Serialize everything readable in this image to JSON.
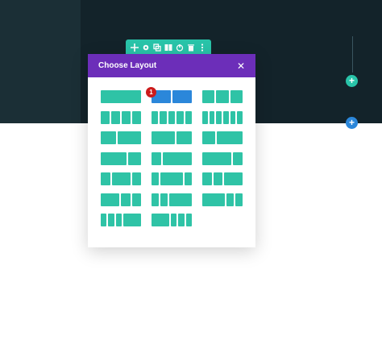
{
  "modal": {
    "title": "Choose Layout",
    "close_glyph": "✕"
  },
  "badge": {
    "count": "1"
  },
  "toolbar": {
    "icons": [
      "move-icon",
      "gear-icon",
      "duplicate-icon",
      "columns-icon",
      "power-icon",
      "trash-icon",
      "more-icon"
    ]
  },
  "side_controls": {
    "add_glyph": "+"
  },
  "colors": {
    "accent": "#29c4a9",
    "header": "#6c2eb9",
    "selected": "#2b87da",
    "badge": "#cc1b1b",
    "dark_bg": "#13232a"
  },
  "layouts": [
    {
      "name": "1 column",
      "cols": [
        4
      ]
    },
    {
      "name": "1/2 + 1/2",
      "cols": [
        1,
        1
      ],
      "selected": true
    },
    {
      "name": "1/3 + 1/3 + 1/3",
      "cols": [
        1,
        1,
        1
      ]
    },
    {
      "name": "1/4 x 4",
      "cols": [
        1,
        1,
        1,
        1
      ]
    },
    {
      "name": "1/5 x 5",
      "cols": [
        1,
        1,
        1,
        1,
        1
      ]
    },
    {
      "name": "1/6 x 6",
      "cols": [
        1,
        1,
        1,
        1,
        1,
        1
      ]
    },
    {
      "name": "2/5 + 3/5",
      "cols": [
        2,
        3
      ]
    },
    {
      "name": "3/5 + 2/5",
      "cols": [
        3,
        2
      ]
    },
    {
      "name": "1/3 + 2/3",
      "cols": [
        1,
        2
      ]
    },
    {
      "name": "2/3 + 1/3",
      "cols": [
        2,
        1
      ]
    },
    {
      "name": "1/4 + 3/4",
      "cols": [
        1,
        3
      ]
    },
    {
      "name": "3/4 + 1/4",
      "cols": [
        3,
        1
      ]
    },
    {
      "name": "1/4 + 1/2 + 1/4",
      "cols": [
        1,
        2,
        1
      ]
    },
    {
      "name": "1/5 + 3/5 + 1/5",
      "cols": [
        1,
        3,
        1
      ]
    },
    {
      "name": "1/4 + 1/4 + 1/2",
      "cols": [
        1,
        1,
        2
      ]
    },
    {
      "name": "1/2 + 1/4 + 1/4",
      "cols": [
        2,
        1,
        1
      ]
    },
    {
      "name": "1/5 + 1/5 + 3/5",
      "cols": [
        1,
        1,
        3
      ]
    },
    {
      "name": "3/5 + 1/5 + 1/5",
      "cols": [
        3,
        1,
        1
      ]
    },
    {
      "name": "1/6 + 1/6 + 1/6 + 1/2",
      "cols": [
        1,
        1,
        1,
        3
      ]
    },
    {
      "name": "1/2 + 1/6 + 1/6 + 1/6",
      "cols": [
        3,
        1,
        1,
        1
      ]
    }
  ]
}
